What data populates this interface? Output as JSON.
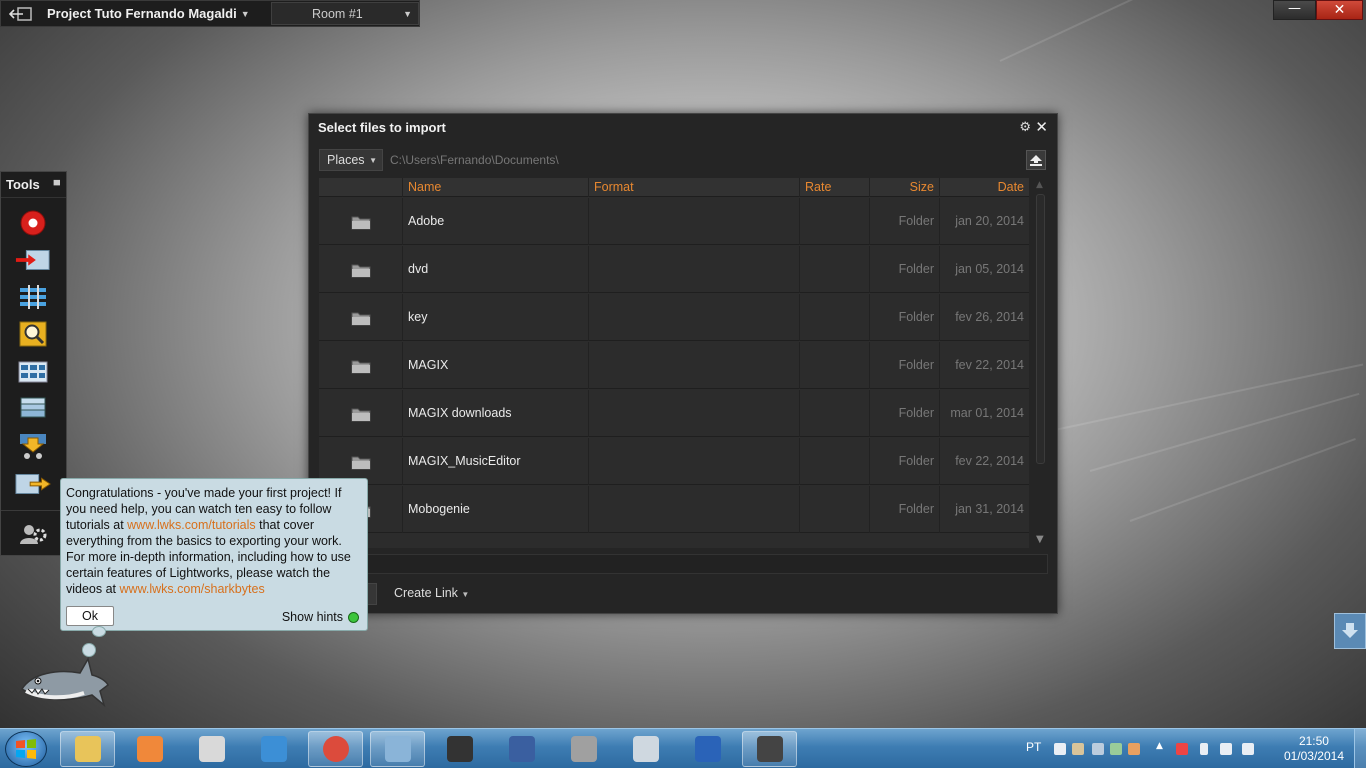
{
  "topbar": {
    "project_title": "Project Tuto Fernando Magaldi",
    "room": "Room #1"
  },
  "window_controls": {
    "minimize": "—",
    "close": "✕"
  },
  "tools": {
    "title": "Tools",
    "items": [
      {
        "name": "record-icon"
      },
      {
        "name": "import-icon"
      },
      {
        "name": "timeline-icon"
      },
      {
        "name": "search-icon"
      },
      {
        "name": "grid-view-icon"
      },
      {
        "name": "bins-icon"
      },
      {
        "name": "download-icon"
      },
      {
        "name": "export-icon"
      },
      {
        "name": "settings-users-icon"
      }
    ]
  },
  "dialog": {
    "title": "Select files to import",
    "places_label": "Places",
    "path": "C:\\Users\\Fernando\\Documents\\",
    "columns": [
      "Name",
      "Format",
      "Rate",
      "Size",
      "Date"
    ],
    "rows": [
      {
        "name": "Adobe",
        "size": "Folder",
        "date": "jan 20, 2014"
      },
      {
        "name": "dvd",
        "size": "Folder",
        "date": "jan 05, 2014"
      },
      {
        "name": "key",
        "size": "Folder",
        "date": "fev 26, 2014"
      },
      {
        "name": "MAGIX",
        "size": "Folder",
        "date": "fev 22, 2014"
      },
      {
        "name": "MAGIX downloads",
        "size": "Folder",
        "date": "mar 01, 2014"
      },
      {
        "name": "MAGIX_MusicEditor",
        "size": "Folder",
        "date": "fev 22, 2014"
      },
      {
        "name": "Mobogenie",
        "size": "Folder",
        "date": "jan 31, 2014"
      }
    ],
    "create_link_label": "Create Link"
  },
  "hint": {
    "text_1": "Congratulations - you've made your first project!  If you need help, you can watch ten easy to follow tutorials at ",
    "link_1": "www.lwks.com/tutorials",
    "text_2": " that cover everything from the basics to exporting your work.  For more in-depth information, including how to use certain features of Lightworks, please watch the videos at ",
    "link_2": "www.lwks.com/sharkbytes",
    "ok_label": "Ok",
    "show_hints_label": "Show hints"
  },
  "taskbar": {
    "apps": [
      "explorer",
      "media-player",
      "media-player-classic",
      "internet-explorer",
      "chrome",
      "music-app",
      "horse-app",
      "pen-app",
      "photo-app",
      "calculator",
      "sigi-app",
      "lightworks"
    ],
    "language": "PT",
    "time": "21:50",
    "date": "01/03/2014"
  },
  "colors": {
    "accent": "#e88830",
    "dialog_bg": "#252525",
    "hint_bg": "#c9dbe3"
  }
}
